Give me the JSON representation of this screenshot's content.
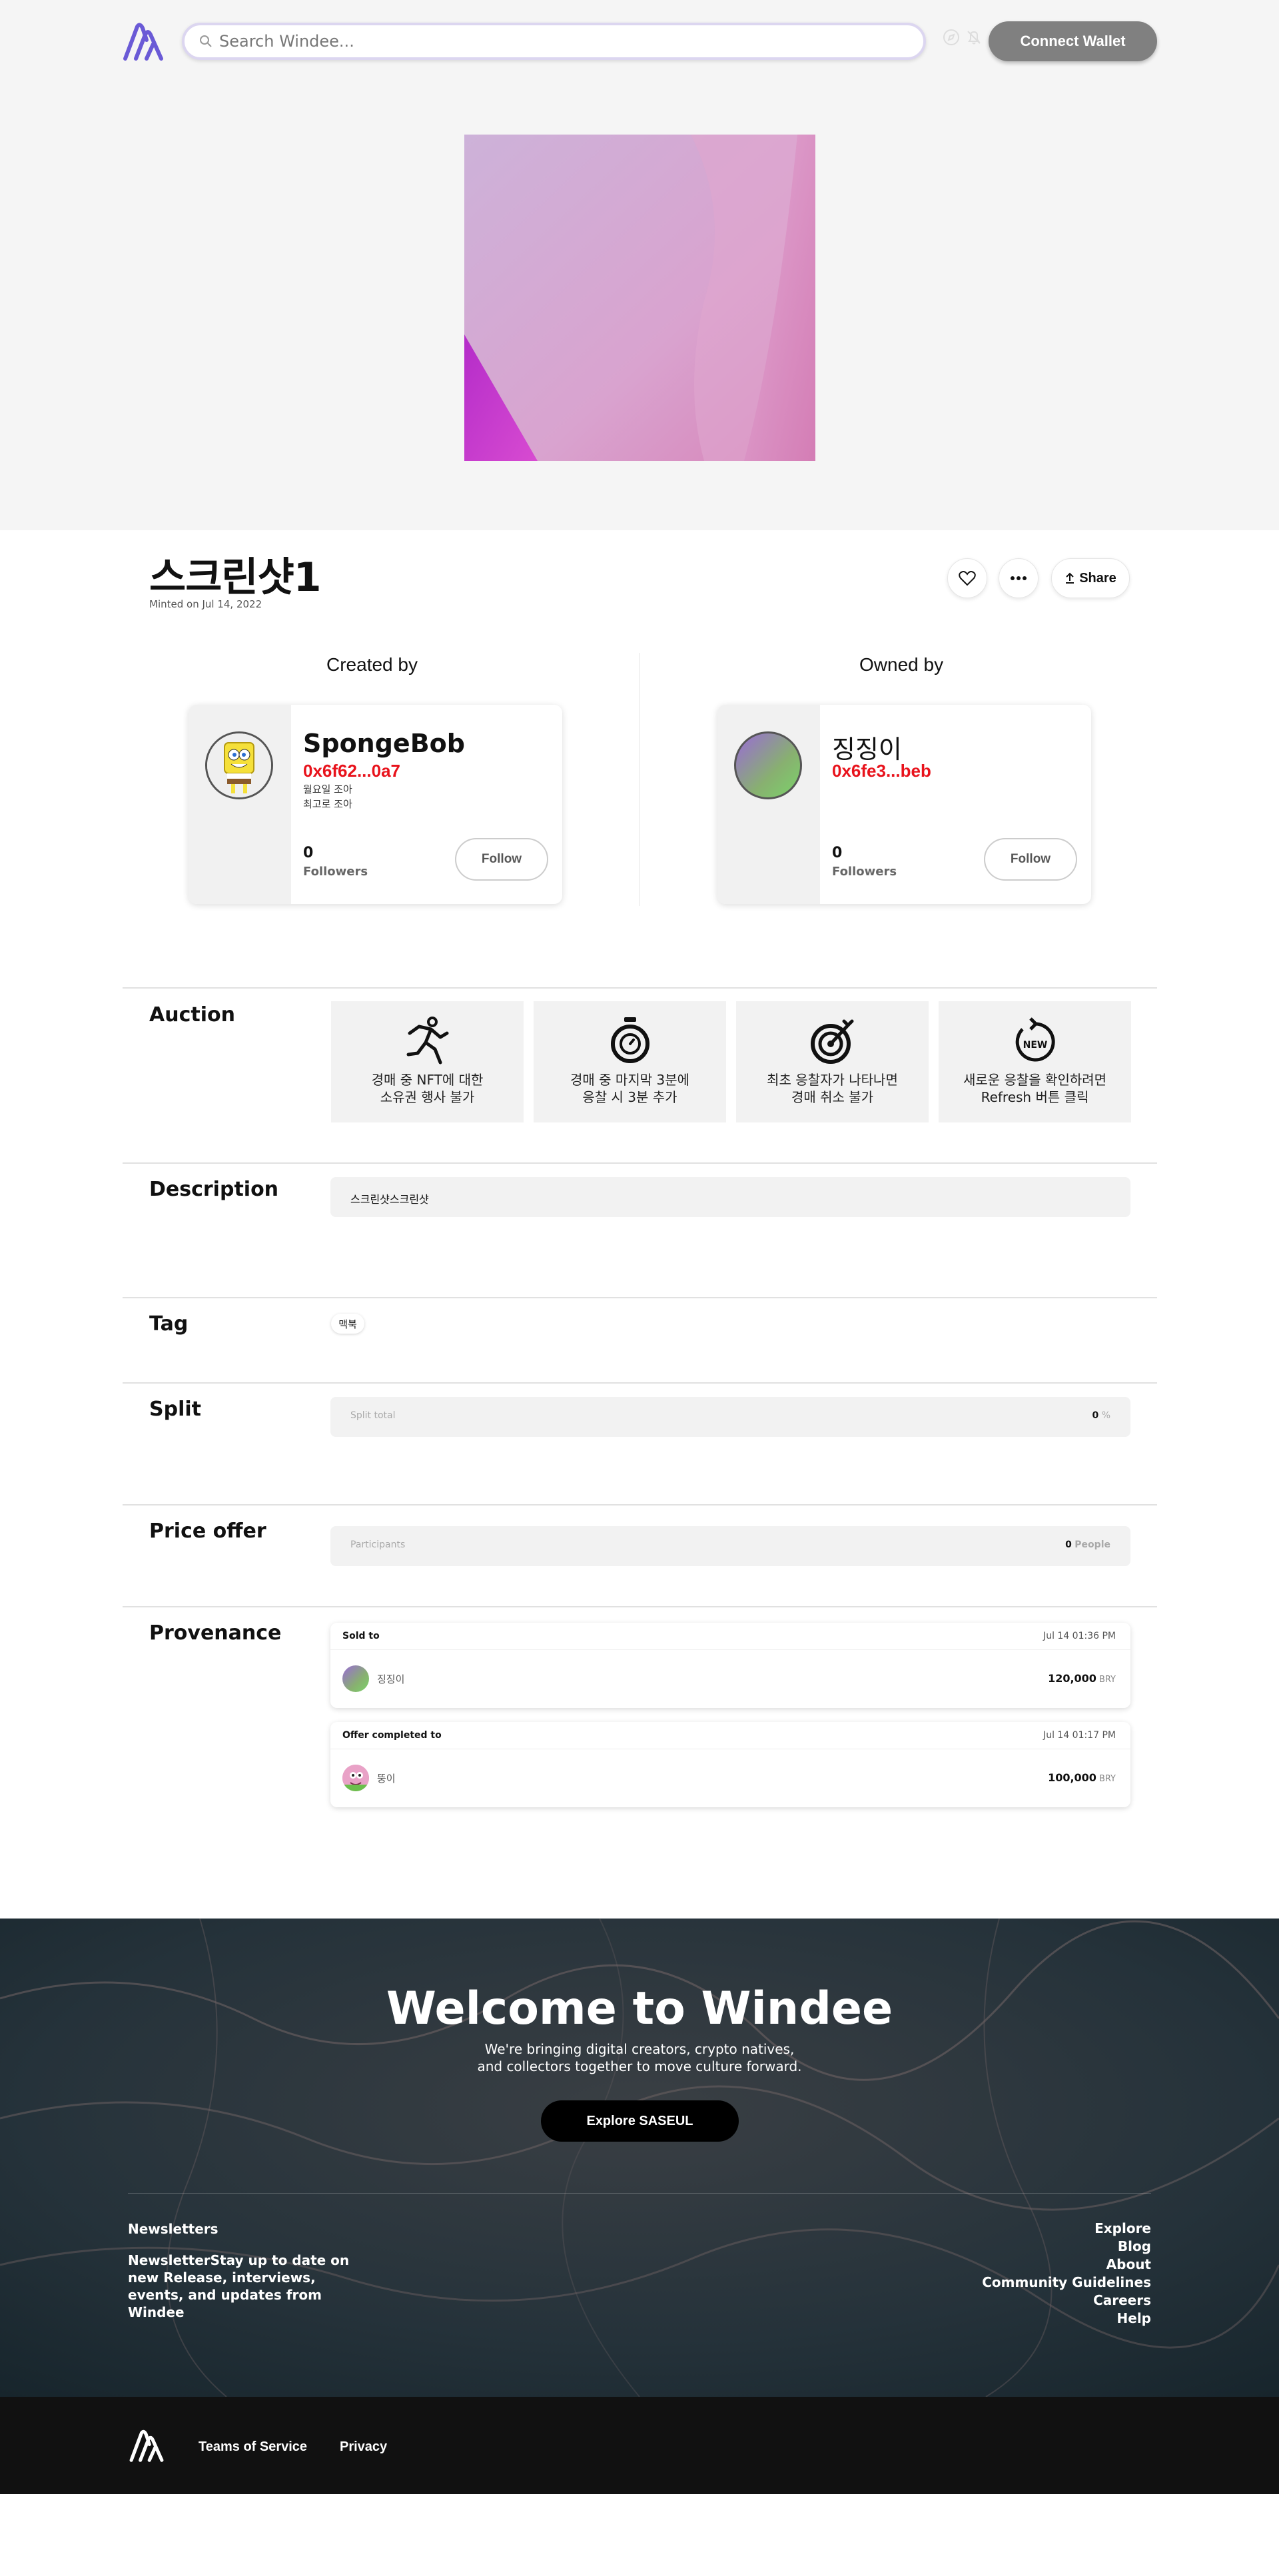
{
  "header": {
    "search_placeholder": "Search Windee...",
    "connect_label": "Connect Wallet",
    "icons": [
      "logo-icon",
      "search-icon",
      "compass-icon",
      "bell-icon"
    ]
  },
  "nft": {
    "title": "스크린샷1",
    "minted": "Minted on Jul 14, 2022",
    "share_label": "Share"
  },
  "creator": {
    "heading": "Created by",
    "name": "SpongeBob",
    "address": "0x6f62...0a7",
    "bio_line1": "월요일 조아",
    "bio_line2": "최고로 조아",
    "followers_count": "0",
    "followers_label": "Followers",
    "follow_label": "Follow"
  },
  "owner": {
    "heading": "Owned by",
    "name": "징징이",
    "address": "0x6fe3...beb",
    "followers_count": "0",
    "followers_label": "Followers",
    "follow_label": "Follow"
  },
  "auction": {
    "label": "Auction",
    "features": [
      {
        "line1": "경매 중 NFT에 대한",
        "line2": "소유권 행사 불가",
        "icon": "running-person-icon"
      },
      {
        "line1": "경매 중 마지막 3분에",
        "line2": "응찰 시 3분 추가",
        "icon": "stopwatch-icon"
      },
      {
        "line1": "최초 응찰자가 나타나면",
        "line2": "경매 취소 불가",
        "icon": "target-icon"
      },
      {
        "line1": "새로운 응찰을 확인하려면",
        "line2": "Refresh 버튼 클릭",
        "icon": "refresh-new-icon"
      }
    ]
  },
  "description": {
    "label": "Description",
    "text": "스크린샷스크린샷"
  },
  "tag": {
    "label": "Tag",
    "value": "맥북"
  },
  "split": {
    "label": "Split",
    "placeholder": "Split total",
    "value": "0",
    "unit": "%"
  },
  "price_offer": {
    "label": "Price offer",
    "placeholder": "Participants",
    "value": "0",
    "unit": "People"
  },
  "provenance": {
    "label": "Provenance",
    "items": [
      {
        "type": "Sold to",
        "date": "Jul 14 01:36 PM",
        "name": "징징이",
        "amount": "120,000",
        "currency": "BRY"
      },
      {
        "type": "Offer completed to",
        "date": "Jul 14 01:17 PM",
        "name": "뚱이",
        "amount": "100,000",
        "currency": "BRY"
      }
    ]
  },
  "footer": {
    "welcome": "Welcome to Windee",
    "tagline1": "We're bringing digital creators, crypto natives,",
    "tagline2": "and collectors together to move culture forward.",
    "explore_label": "Explore SASEUL",
    "newsletter_title": "Newsletters",
    "newsletter_body": "NewsletterStay up to date on new Release, interviews, events, and updates from Windee",
    "links": [
      "Explore",
      "Blog",
      "About",
      "Community Guidelines",
      "Careers",
      "Help"
    ],
    "terms": "Teams of Service",
    "privacy": "Privacy"
  },
  "colors": {
    "accent": "#6a5ad6",
    "address_red": "#e8121b",
    "connect_bg": "#808080"
  }
}
